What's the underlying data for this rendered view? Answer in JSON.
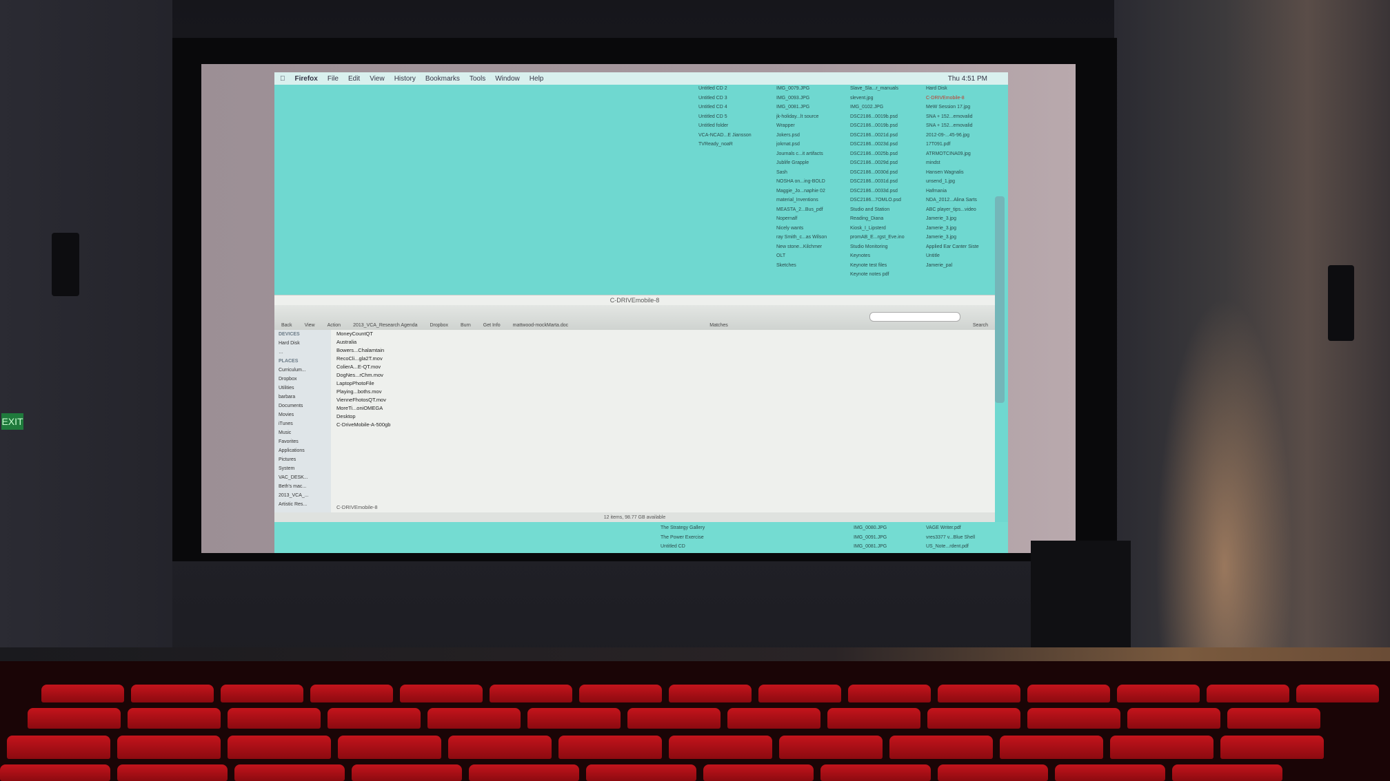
{
  "scene": {
    "exit_sign": "EXIT"
  },
  "menubar": {
    "items": [
      "Firefox",
      "File",
      "Edit",
      "View",
      "History",
      "Bookmarks",
      "Tools",
      "Window",
      "Help"
    ],
    "clock": "Thu 4:51 PM"
  },
  "desktop_icons": {
    "col1": [
      "Untitled CD 2",
      "Untitled CD 3",
      "Untitled CD 4",
      "Untitled CD 5",
      "Untitled folder",
      "VCA-NCAD...E Jiansson",
      "TVReady_noaR"
    ],
    "col2": [
      "IMG_0079.JPG",
      "IMG_0093.JPG",
      "IMG_0081.JPG",
      "jk-holiday...lt source",
      "Wrapper",
      "Jokers.psd",
      "jokmat.psd",
      "Journals c...it artifacts",
      "Jublife Grapple",
      "Sash",
      "NOSHA on...ing-BOLD",
      "Maggie_Jo...naphie 02",
      "material_Inventions",
      "MEASTA_2...Bus_pdf",
      "Nopernalf",
      "Nicely wants",
      "ray Smith_c...as Wilson",
      "New stone...Kilchmer",
      "OLT",
      "Sketches"
    ],
    "col3": [
      "Slave_Sla...r_manuals",
      "slevent.jpg",
      "IMG_0102.JPG",
      "DSC2186...0019b.psd",
      "DSC2186...0019b.psd",
      "DSC2186...0021d.psd",
      "DSC2186...0023d.psd",
      "DSC2186...0025b.psd",
      "DSC2186...0029d.psd",
      "DSC2186...0030d.psd",
      "DSC2186...0031d.psd",
      "DSC2186...0033d.psd",
      "DSC2186...7OMLO.psd",
      "Studio and Station",
      "Reading_Diana",
      "Kiosk_I_Lipsterd",
      "promAB_E...rgst_Eve.ino",
      "Studio Monitoring",
      "Keynotes",
      "Keynote test files",
      "Keynote notes pdf"
    ],
    "col4": [
      "Hard Disk",
      "C-DRIVEmobile-8",
      "MeW Session 17.jpg",
      "SNA + 152...emovalid",
      "SNA + 152...emovalid",
      "2012-09-...45-96.jpg",
      "17T091.pdf",
      "ATRMOTCINA09.jpg",
      "mindst",
      "Hansen Wagnalis",
      "unsend_1.jpg",
      "Hafmania",
      "NDA_2012...Alina Sarts",
      "ABC player_tips...video",
      "Jamerie_3.jpg",
      "Jamerie_3.jpg",
      "Jamerie_3.jpg",
      "Applied Ear Canter Siste",
      "Untitle",
      "Jamerie_pal"
    ],
    "bottom_col1": [
      "The Strategy Gallery",
      "The Power Exercise",
      "Untitled CD"
    ],
    "bottom_col2": [
      "IMG_0080.JPG",
      "IMG_0091.JPG",
      "IMG_0081.JPG"
    ],
    "bottom_col3": [
      "VAGE Writer.pdf",
      "vres3377 v...Blue Shell",
      "US_Note...rdent.pdf"
    ]
  },
  "finder": {
    "title": "C-DRIVEmobile-8",
    "toolbar": [
      "Back",
      "View",
      "Action",
      "2013_VCA_Research Agenda",
      "Dropbox",
      "Burn",
      "Get Info",
      "mattwood-mockMarta.doc",
      "Matches",
      "Search"
    ],
    "sidebar_devices_header": "DEVICES",
    "sidebar_devices": [
      "Hard Disk",
      "…"
    ],
    "sidebar_places_header": "PLACES",
    "sidebar_places": [
      "Curriculum...",
      "Dropbox",
      "Utilities",
      "barbara",
      "Documents",
      "Movies",
      "iTunes",
      "Music",
      "Favorites",
      "Applications",
      "Pictures",
      "System",
      "VAC_DESK...",
      "Beth's mac...",
      "2013_VCA_...",
      "Artistic Res..."
    ],
    "files": [
      "MoneyCountQT",
      "Australia",
      "Bowers...Chalamtain",
      "RecoCli...gla2T.mov",
      "ColierA...E-QT.mov",
      "DogNes...rChm.mov",
      "LaptopPhotoFile",
      "Playing...boths.mov",
      "VienneFhotosQT.mov",
      "MoreTi...oniOMEGA",
      "Desktop",
      "C-DriveMobile-A-500gb"
    ],
    "path": "C-DRIVEmobile-8",
    "status": "12 items, 98.77 GB available"
  }
}
